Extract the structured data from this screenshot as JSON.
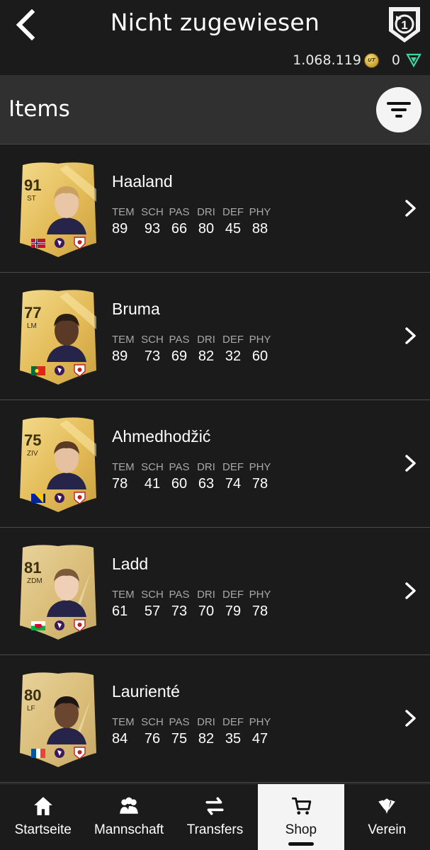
{
  "header": {
    "title": "Nicht zugewiesen",
    "coins": "1.068.119",
    "coin_icon_label": "UT",
    "points": "0"
  },
  "items_bar": {
    "title": "Items"
  },
  "players": [
    {
      "rating": "91",
      "position": "ST",
      "name": "Haaland",
      "stats": [
        "89",
        "93",
        "66",
        "80",
        "45",
        "88"
      ],
      "card_style": "gold-rare",
      "flag": "norway",
      "skin": "#e9c6a6",
      "hair": "#c9a163"
    },
    {
      "rating": "77",
      "position": "LM",
      "name": "Bruma",
      "stats": [
        "89",
        "73",
        "69",
        "82",
        "32",
        "60"
      ],
      "card_style": "gold-rare",
      "flag": "portugal",
      "skin": "#5a3a26",
      "hair": "#2a1d14"
    },
    {
      "rating": "75",
      "position": "ZIV",
      "name": "Ahmedhodžić",
      "stats": [
        "78",
        "41",
        "60",
        "63",
        "74",
        "78"
      ],
      "card_style": "gold-rare",
      "flag": "bosnia",
      "skin": "#e5c1a2",
      "hair": "#5a3a22"
    },
    {
      "rating": "81",
      "position": "ZDM",
      "name": "Ladd",
      "stats": [
        "61",
        "57",
        "73",
        "70",
        "79",
        "78"
      ],
      "card_style": "gold-common",
      "flag": "wales",
      "skin": "#efd0b6",
      "hair": "#7a5a3a"
    },
    {
      "rating": "80",
      "position": "LF",
      "name": "Laurienté",
      "stats": [
        "84",
        "76",
        "75",
        "82",
        "35",
        "47"
      ],
      "card_style": "gold-common",
      "flag": "france",
      "skin": "#6a4530",
      "hair": "#1e1612"
    }
  ],
  "stat_labels": [
    "TEM",
    "SCH",
    "PAS",
    "DRI",
    "DEF",
    "PHY"
  ],
  "nav": [
    {
      "label": "Startseite",
      "icon": "home-icon",
      "active": false
    },
    {
      "label": "Mannschaft",
      "icon": "squad-icon",
      "active": false
    },
    {
      "label": "Transfers",
      "icon": "transfers-icon",
      "active": false
    },
    {
      "label": "Shop",
      "icon": "cart-icon",
      "active": true
    },
    {
      "label": "Verein",
      "icon": "club-icon",
      "active": false
    }
  ],
  "colors": {
    "background": "#1b1b1b",
    "bar": "#303030",
    "gold": "#e8c468",
    "active_nav": "#f4f4f4"
  }
}
